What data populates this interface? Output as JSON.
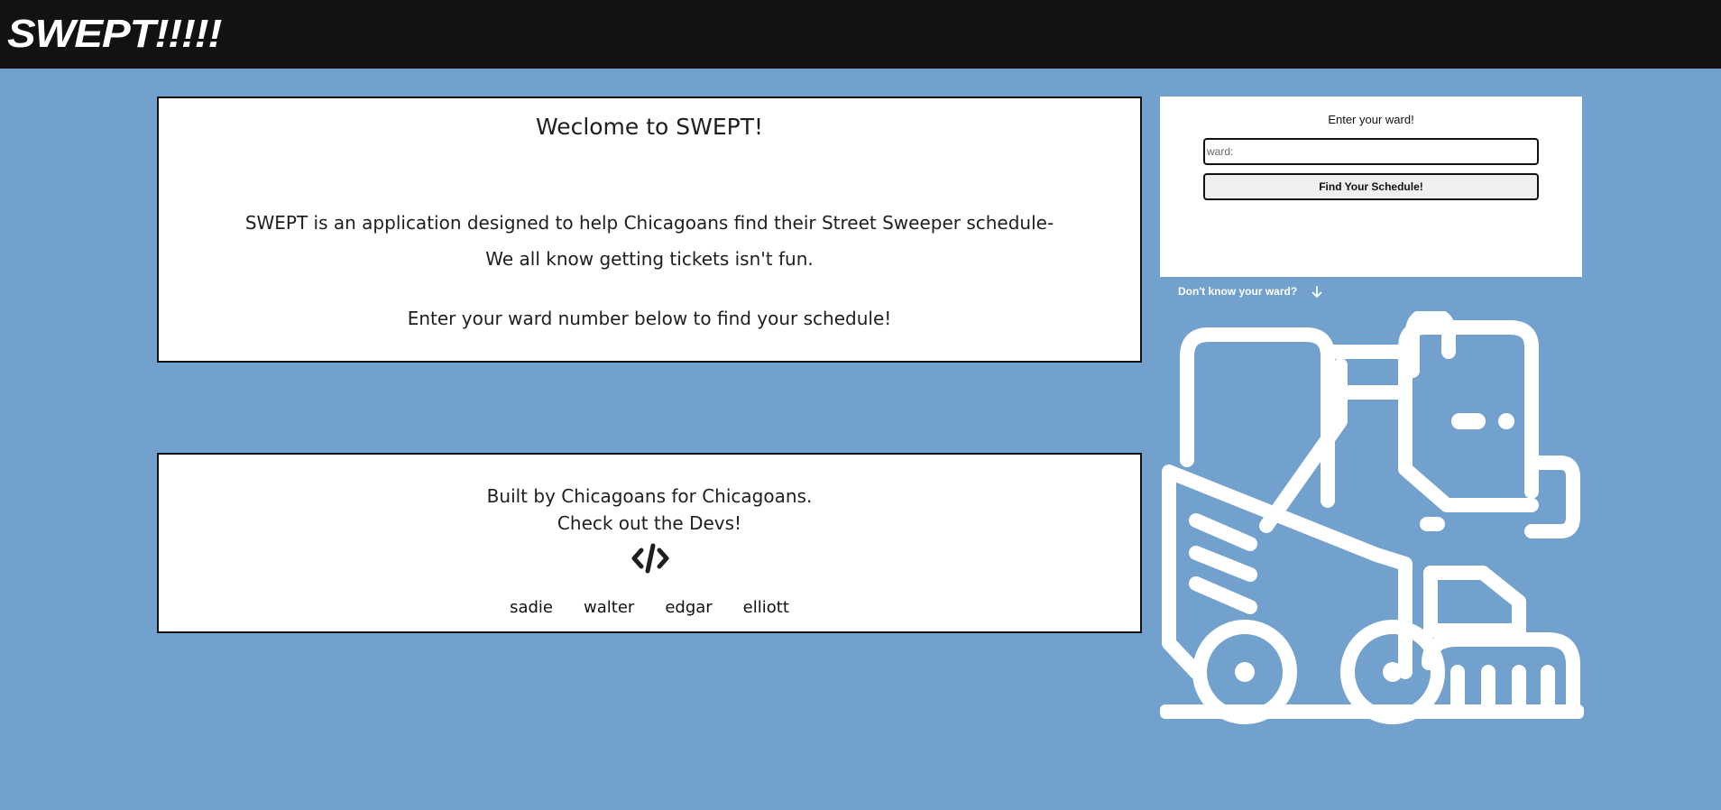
{
  "header": {
    "logo_text": "SWEPT!!!!!"
  },
  "welcome": {
    "title": "Weclome to SWEPT!",
    "line1": "SWEPT is an application designed to help Chicagoans find their Street Sweeper schedule-",
    "line2": "We all know getting tickets isn't fun.",
    "line3": "Enter your ward number below to find your schedule!"
  },
  "footer": {
    "line1": "Built by Chicagoans for Chicagoans.",
    "line2": "Check out the Devs!",
    "icon": "code-icon",
    "devs": [
      "sadie",
      "walter",
      "edgar",
      "elliott"
    ]
  },
  "ward_form": {
    "heading": "Enter your ward!",
    "input_value": "",
    "input_placeholder": "ward:",
    "button_label": "Find Your Schedule!",
    "help_text": "Don't know your ward?",
    "help_icon": "arrow-down-icon"
  },
  "illustration": {
    "icon": "street-sweeper-icon"
  },
  "colors": {
    "background": "#72a1cd",
    "topbar": "#141210",
    "card": "#ffffff",
    "text": "#1e1e1e"
  }
}
